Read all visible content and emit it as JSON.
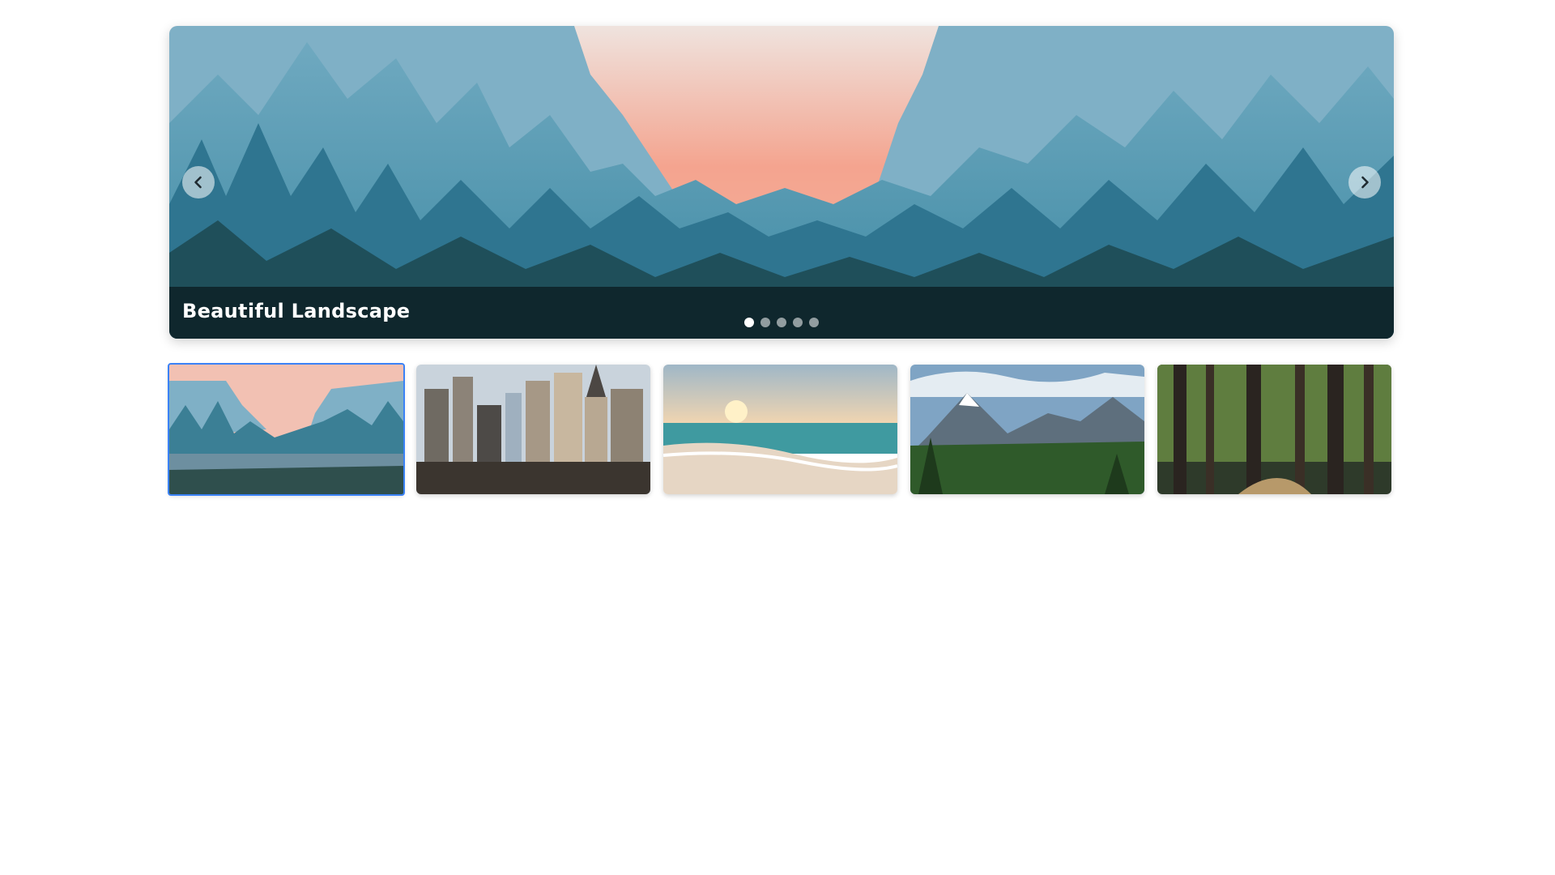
{
  "slider": {
    "caption": "Beautiful Landscape",
    "prev_icon": "chevron-left-icon",
    "next_icon": "chevron-right-icon",
    "slide_count": 5,
    "active_index": 0
  },
  "thumbnails": [
    {
      "name": "valley-landscape",
      "active": true
    },
    {
      "name": "city-skyline",
      "active": false
    },
    {
      "name": "beach-sunset",
      "active": false
    },
    {
      "name": "mountain-range",
      "active": false
    },
    {
      "name": "forest-path",
      "active": false
    }
  ],
  "colors": {
    "active_thumb_border": "#3b82f6",
    "caption_bg": "rgba(0,0,0,0.5)"
  }
}
